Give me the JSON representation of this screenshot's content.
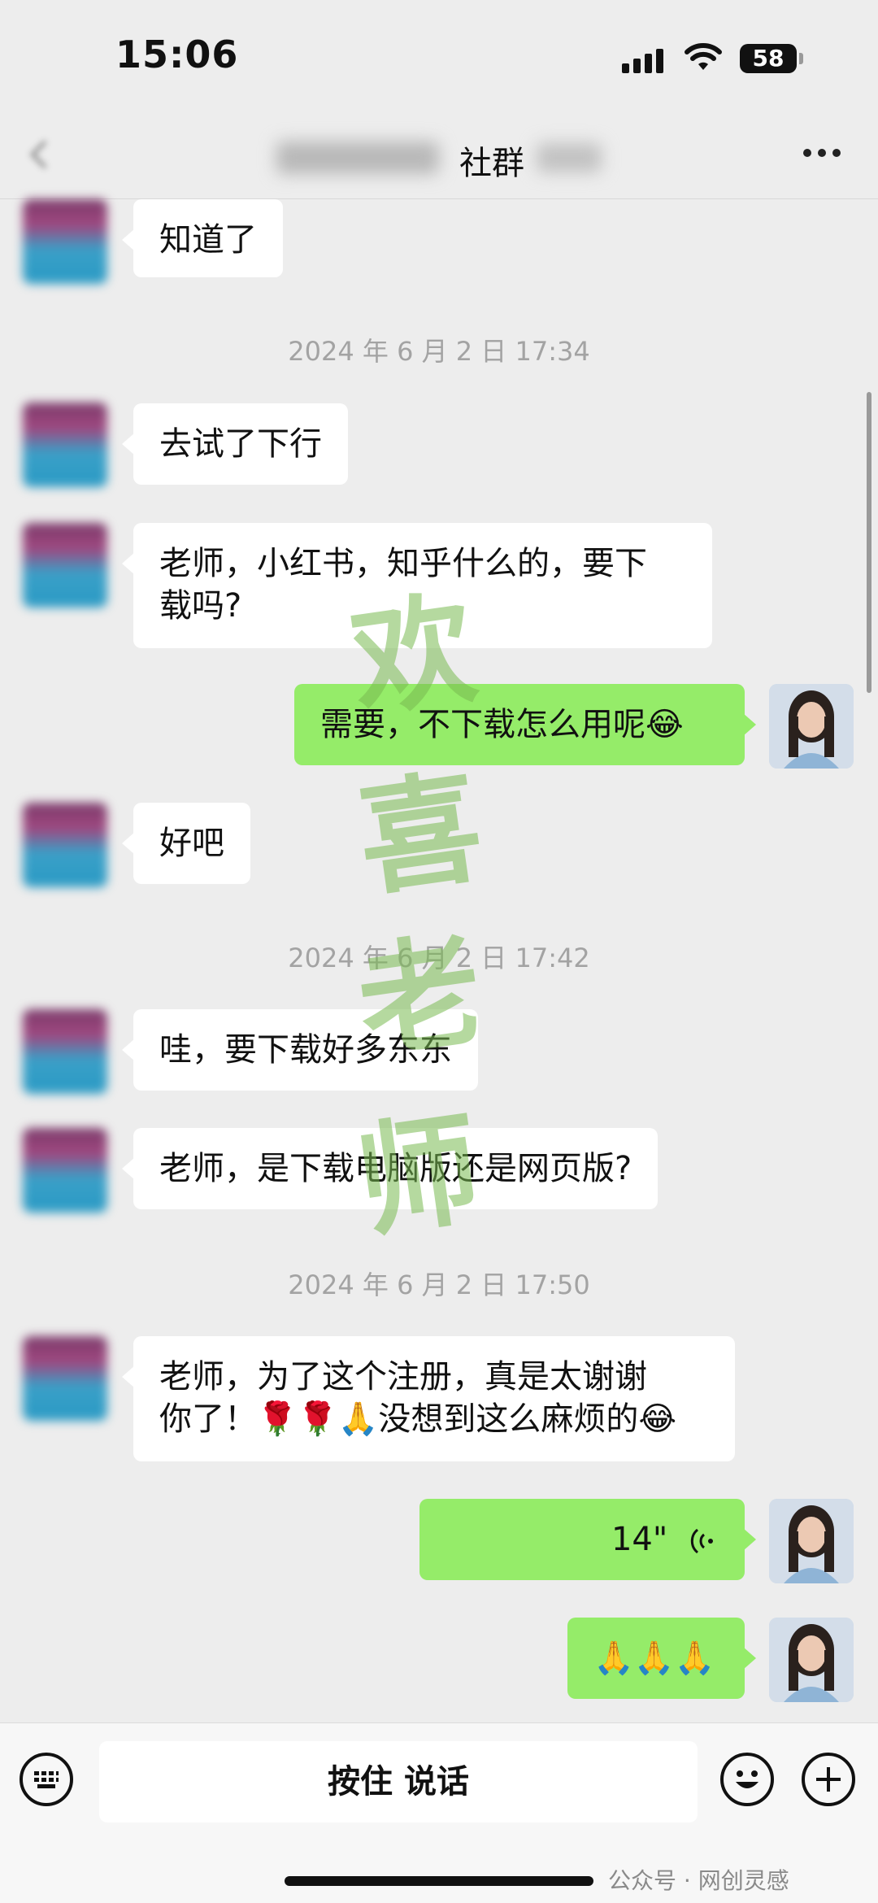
{
  "status_bar": {
    "time": "15:06",
    "battery": "58"
  },
  "nav": {
    "title": "社群"
  },
  "messages": [
    {
      "kind": "in",
      "text": "知道了"
    },
    {
      "kind": "timestamp",
      "text": "2024 年 6 月 2 日 17:34"
    },
    {
      "kind": "in",
      "text": "去试了下行"
    },
    {
      "kind": "in",
      "line1": "老师，小红书，知乎什么的，要下",
      "line2": "载吗?"
    },
    {
      "kind": "out",
      "text": "需要，不下载怎么用呢😂"
    },
    {
      "kind": "in",
      "text": "好吧"
    },
    {
      "kind": "timestamp",
      "text": "2024 年 6 月 2 日 17:42"
    },
    {
      "kind": "in",
      "text": "哇，要下载好多东东"
    },
    {
      "kind": "in",
      "text": "老师，是下载电脑版还是网页版?"
    },
    {
      "kind": "timestamp",
      "text": "2024 年 6 月 2 日 17:50"
    },
    {
      "kind": "in",
      "line1": "老师，为了这个注册，真是太谢谢",
      "line2": "你了！🌹🌹🙏没想到这么麻烦的😂"
    },
    {
      "kind": "out_voice",
      "duration": "14\""
    },
    {
      "kind": "out",
      "text": "🙏🙏🙏"
    }
  ],
  "watermark": [
    "欢",
    "喜",
    "老",
    "师"
  ],
  "input_bar": {
    "hold_to_talk": "按住 说话"
  },
  "credit": "公众号 · 网创灵感",
  "colors": {
    "bubble_out": "#95ec69",
    "bubble_in": "#ffffff",
    "background": "#ededed"
  }
}
